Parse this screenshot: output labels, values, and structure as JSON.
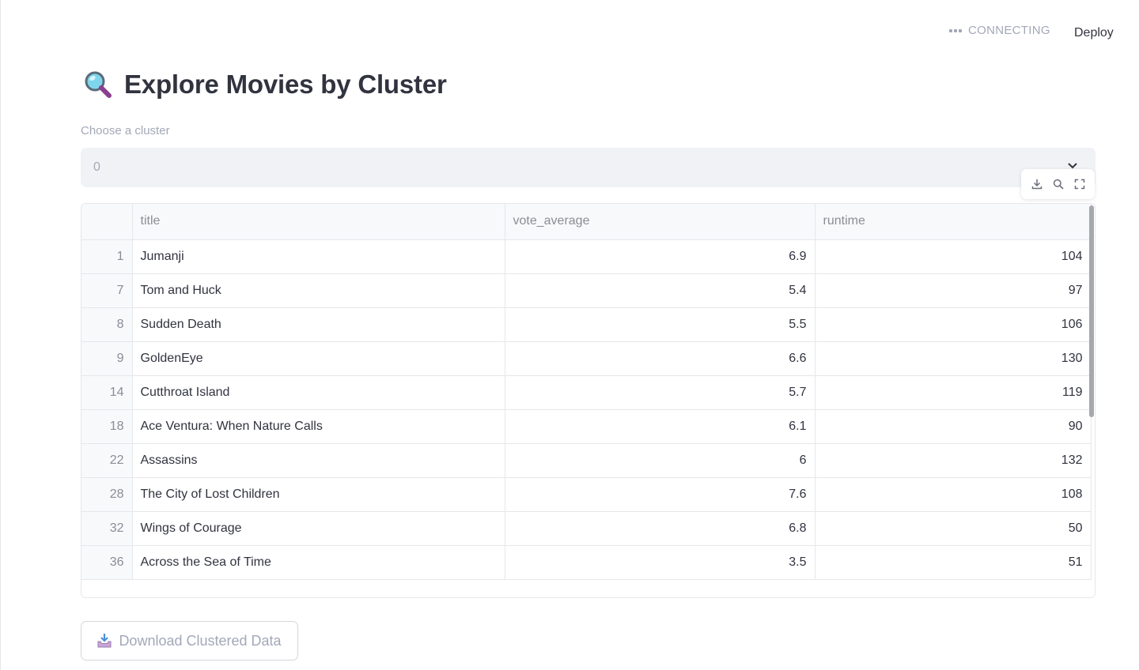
{
  "header": {
    "status_text": "CONNECTING",
    "deploy_label": "Deploy"
  },
  "page": {
    "title": "Explore Movies by Cluster",
    "title_icon": "magnifying-glass-icon"
  },
  "cluster_select": {
    "label": "Choose a cluster",
    "value": "0",
    "icon": "chevron-down-icon"
  },
  "table_toolbar": {
    "icons": [
      "download-icon",
      "search-icon",
      "fullscreen-icon"
    ]
  },
  "table": {
    "columns": [
      "",
      "title",
      "vote_average",
      "runtime"
    ],
    "rows": [
      {
        "index": "1",
        "title": "Jumanji",
        "vote_average": "6.9",
        "runtime": "104"
      },
      {
        "index": "7",
        "title": "Tom and Huck",
        "vote_average": "5.4",
        "runtime": "97"
      },
      {
        "index": "8",
        "title": "Sudden Death",
        "vote_average": "5.5",
        "runtime": "106"
      },
      {
        "index": "9",
        "title": "GoldenEye",
        "vote_average": "6.6",
        "runtime": "130"
      },
      {
        "index": "14",
        "title": "Cutthroat Island",
        "vote_average": "5.7",
        "runtime": "119"
      },
      {
        "index": "18",
        "title": "Ace Ventura: When Nature Calls",
        "vote_average": "6.1",
        "runtime": "90"
      },
      {
        "index": "22",
        "title": "Assassins",
        "vote_average": "6",
        "runtime": "132"
      },
      {
        "index": "28",
        "title": "The City of Lost Children",
        "vote_average": "7.6",
        "runtime": "108"
      },
      {
        "index": "32",
        "title": "Wings of Courage",
        "vote_average": "6.8",
        "runtime": "50"
      },
      {
        "index": "36",
        "title": "Across the Sea of Time",
        "vote_average": "3.5",
        "runtime": "51"
      }
    ]
  },
  "download_button": {
    "label": "Download Clustered Data",
    "icon": "inbox-tray-icon"
  },
  "colors": {
    "text": "#31333f",
    "muted": "#a3a8b8",
    "select_bg": "#f0f2f6",
    "border": "#e6e7eb"
  }
}
